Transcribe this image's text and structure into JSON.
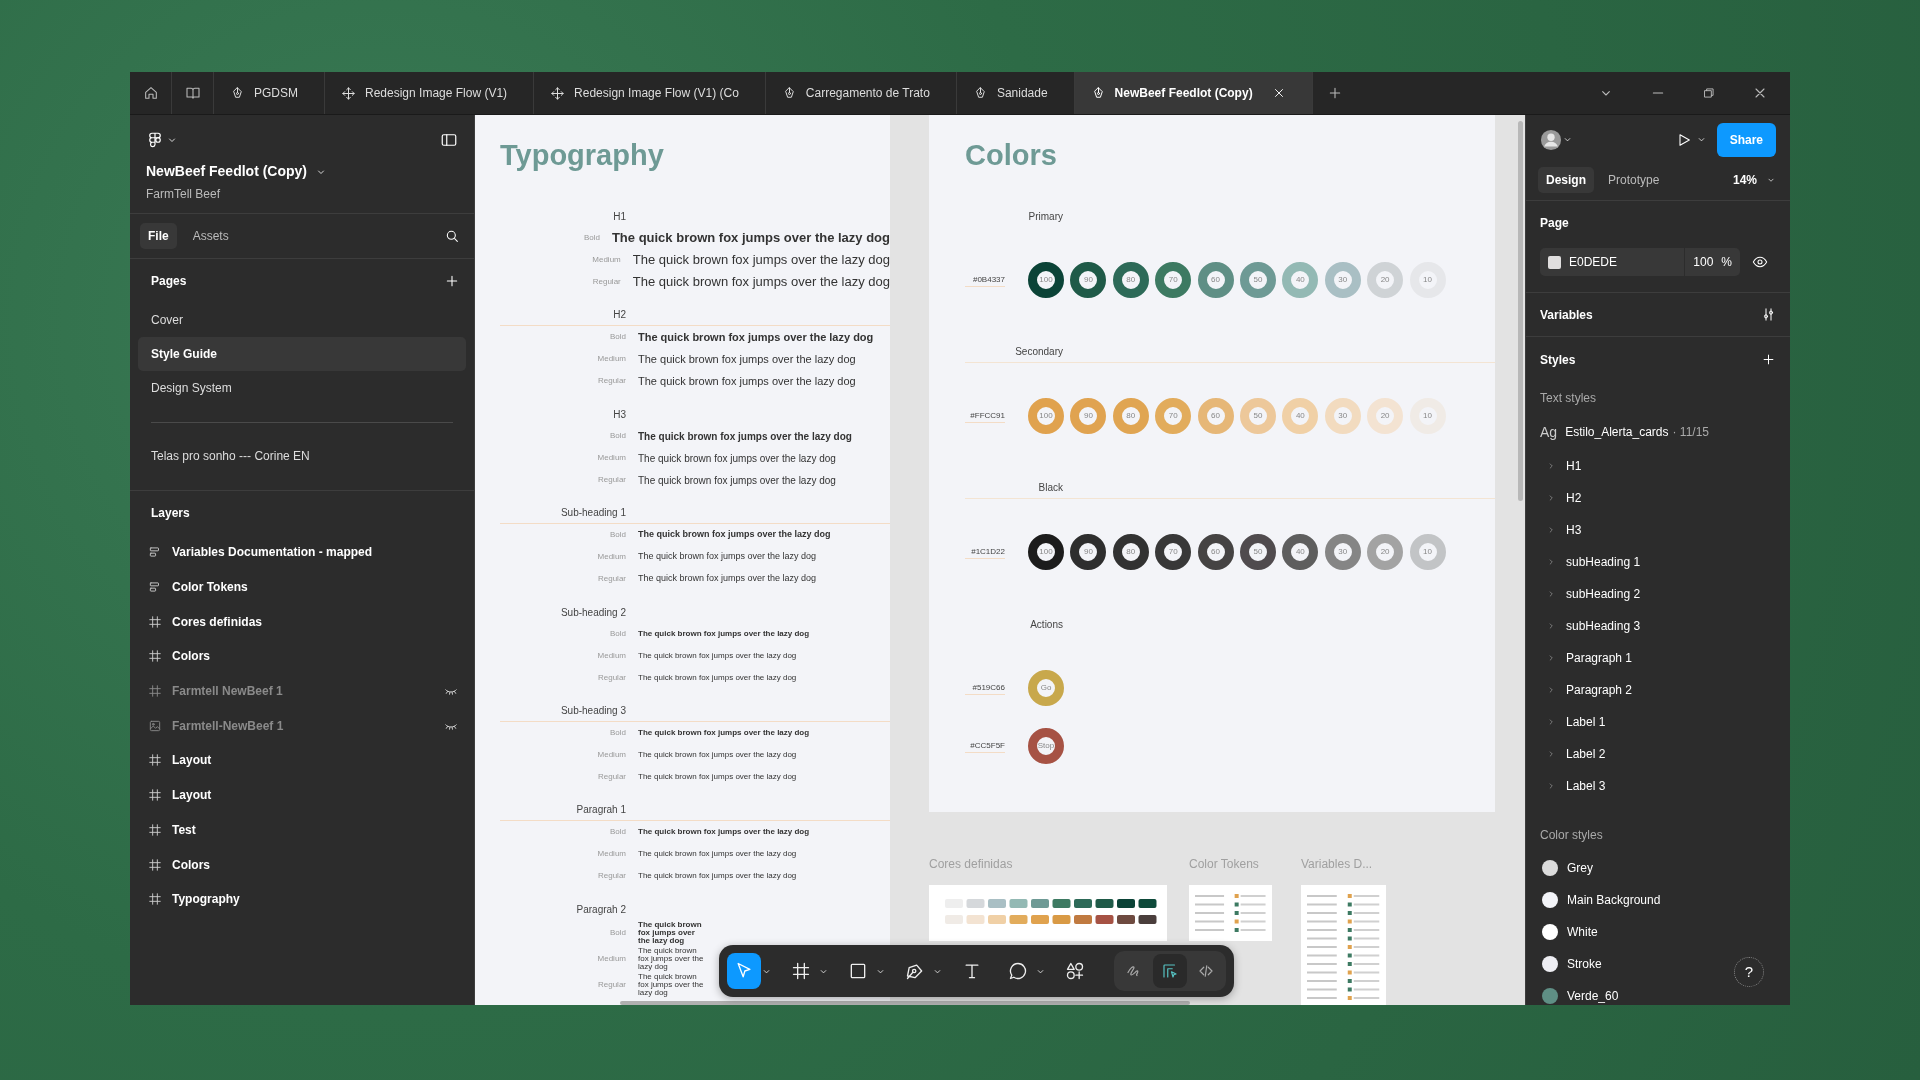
{
  "tabs": [
    {
      "label": "PGDSM",
      "kind": "design",
      "selected": false
    },
    {
      "label": "Redesign Image Flow (V1)",
      "kind": "flow",
      "selected": false
    },
    {
      "label": "Redesign Image Flow (V1) (Co",
      "kind": "flow",
      "selected": false
    },
    {
      "label": "Carregamento de Trato",
      "kind": "design",
      "selected": false
    },
    {
      "label": "Sanidade",
      "kind": "design",
      "selected": false
    },
    {
      "label": "NewBeef Feedlot (Copy)",
      "kind": "design",
      "selected": true
    }
  ],
  "left_panel": {
    "file_name": "NewBeef Feedlot (Copy)",
    "team": "FarmTell Beef",
    "tabs": [
      {
        "label": "File",
        "selected": true
      },
      {
        "label": "Assets",
        "selected": false
      }
    ],
    "pages_title": "Pages",
    "pages": [
      {
        "kind": "page",
        "label": "Cover",
        "selected": false
      },
      {
        "kind": "page",
        "label": "Style Guide",
        "selected": true
      },
      {
        "kind": "page",
        "label": "Design System",
        "selected": false
      },
      {
        "kind": "divider",
        "selected": false
      },
      {
        "kind": "page",
        "label": "Telas pro sonho --- Corine EN",
        "selected": false
      }
    ],
    "layers_title": "Layers",
    "layers": [
      {
        "label": "Variables Documentation - mapped",
        "kind": "section",
        "hidden": false
      },
      {
        "label": "Color Tokens",
        "kind": "section",
        "hidden": false
      },
      {
        "label": "Cores definidas",
        "kind": "frame",
        "hidden": false
      },
      {
        "label": "Colors",
        "kind": "frame",
        "hidden": false
      },
      {
        "label": "Farmtell NewBeef 1",
        "kind": "frame",
        "hidden": true
      },
      {
        "label": "Farmtell-NewBeef 1",
        "kind": "image",
        "hidden": true
      },
      {
        "label": "Layout",
        "kind": "frame",
        "hidden": false
      },
      {
        "label": "Layout",
        "kind": "frame",
        "hidden": false
      },
      {
        "label": "Test",
        "kind": "frame",
        "hidden": false
      },
      {
        "label": "Colors",
        "kind": "frame",
        "hidden": false
      },
      {
        "label": "Typography",
        "kind": "frame",
        "hidden": false
      }
    ]
  },
  "canvas": {
    "typography": {
      "title": "Typography",
      "sections": [
        {
          "heading": "H1",
          "rule": false,
          "rows": [
            {
              "kind": "bold",
              "label": "Bold",
              "sample": "The quick brown fox jumps over the lazy dog"
            },
            {
              "kind": "medium",
              "label": "Medium",
              "sample": "The quick brown fox jumps over the lazy dog"
            },
            {
              "kind": "regular",
              "label": "Regular",
              "sample": "The quick brown fox jumps over the lazy dog"
            }
          ]
        },
        {
          "heading": "H2",
          "rule": true,
          "rows": [
            {
              "kind": "bold",
              "label": "Bold",
              "sample": "The quick brown fox jumps over the lazy dog"
            },
            {
              "kind": "medium",
              "label": "Medium",
              "sample": "The quick brown fox jumps over the lazy dog"
            },
            {
              "kind": "regular",
              "label": "Regular",
              "sample": "The quick brown fox jumps over the lazy dog"
            }
          ]
        },
        {
          "heading": "H3",
          "rule": false,
          "rows": [
            {
              "kind": "bold",
              "label": "Bold",
              "sample": "The quick brown fox jumps over the lazy dog"
            },
            {
              "kind": "medium",
              "label": "Medium",
              "sample": "The quick brown fox jumps over the lazy dog"
            },
            {
              "kind": "regular",
              "label": "Regular",
              "sample": "The quick brown fox jumps over the lazy dog"
            }
          ]
        },
        {
          "heading": "Sub-heading 1",
          "rule": true,
          "rows": [
            {
              "kind": "bold",
              "label": "Bold",
              "sample": "The quick brown fox jumps over the lazy dog"
            },
            {
              "kind": "medium",
              "label": "Medium",
              "sample": "The quick brown fox jumps over the lazy dog"
            },
            {
              "kind": "regular",
              "label": "Regular",
              "sample": "The quick brown fox jumps over the lazy dog"
            }
          ]
        },
        {
          "heading": "Sub-heading 2",
          "rule": false,
          "rows": [
            {
              "kind": "bold",
              "label": "Bold",
              "sample": "The quick brown fox jumps over the lazy dog"
            },
            {
              "kind": "medium",
              "label": "Medium",
              "sample": "The quick brown fox jumps over the lazy dog"
            },
            {
              "kind": "regular",
              "label": "Regular",
              "sample": "The quick brown fox jumps over the lazy dog"
            }
          ]
        },
        {
          "heading": "Sub-heading 3",
          "rule": true,
          "rows": [
            {
              "kind": "bold",
              "label": "Bold",
              "sample": "The quick brown fox jumps over the lazy dog"
            },
            {
              "kind": "medium",
              "label": "Medium",
              "sample": "The quick brown fox jumps over the lazy dog"
            },
            {
              "kind": "regular",
              "label": "Regular",
              "sample": "The quick brown fox jumps over the lazy dog"
            }
          ]
        },
        {
          "heading": "Paragrah 1",
          "rule": true,
          "rows": [
            {
              "kind": "bold",
              "label": "Bold",
              "sample": "The quick brown fox jumps over the lazy dog"
            },
            {
              "kind": "medium",
              "label": "Medium",
              "sample": "The quick brown fox jumps over the lazy dog"
            },
            {
              "kind": "regular",
              "label": "Regular",
              "sample": "The quick brown fox jumps over the lazy dog"
            }
          ]
        },
        {
          "heading": "Paragrah 2",
          "rule": false,
          "rows": [
            {
              "kind": "bold",
              "label": "Bold",
              "sample": "The quick brown fox jumps over the lazy dog"
            },
            {
              "kind": "medium",
              "label": "Medium",
              "sample": "The quick brown fox jumps over the lazy dog"
            },
            {
              "kind": "regular",
              "label": "Regular",
              "sample": "The quick brown fox jumps over the lazy dog"
            }
          ]
        }
      ]
    },
    "colors": {
      "title": "Colors",
      "groups": [
        {
          "label": "Primary",
          "rule": false,
          "rows": [
            {
              "hex": "#0B4337",
              "swatches": [
                {
                  "label": "100",
                  "color": "#0b4337"
                },
                {
                  "label": "90",
                  "color": "#1f5a48"
                },
                {
                  "label": "80",
                  "color": "#2d6a58"
                },
                {
                  "label": "70",
                  "color": "#3d7a62"
                },
                {
                  "label": "60",
                  "color": "#5f8f85"
                },
                {
                  "label": "50",
                  "color": "#6e9a95"
                },
                {
                  "label": "40",
                  "color": "#93b9b4"
                },
                {
                  "label": "30",
                  "color": "#a9bfc4"
                },
                {
                  "label": "20",
                  "color": "#cfd3d6"
                },
                {
                  "label": "10",
                  "color": "#e6e7ea"
                }
              ]
            }
          ]
        },
        {
          "label": "Secondary",
          "rule": true,
          "rows": [
            {
              "hex": "#FFCC91",
              "swatches": [
                {
                  "label": "100",
                  "color": "#e0a24e"
                },
                {
                  "label": "90",
                  "color": "#e0a350"
                },
                {
                  "label": "80",
                  "color": "#e0a552"
                },
                {
                  "label": "70",
                  "color": "#e2ac5c"
                },
                {
                  "label": "60",
                  "color": "#e6b777"
                },
                {
                  "label": "50",
                  "color": "#edc89a"
                },
                {
                  "label": "40",
                  "color": "#f0d0a6"
                },
                {
                  "label": "30",
                  "color": "#f2dbbf"
                },
                {
                  "label": "20",
                  "color": "#f3e3d2"
                },
                {
                  "label": "10",
                  "color": "#f0ebe6"
                }
              ]
            }
          ]
        },
        {
          "label": "Black",
          "rule": true,
          "rows": [
            {
              "hex": "#1C1D22",
              "swatches": [
                {
                  "label": "100",
                  "color": "#1c1c1c"
                },
                {
                  "label": "90",
                  "color": "#2e2e2e"
                },
                {
                  "label": "80",
                  "color": "#323232"
                },
                {
                  "label": "70",
                  "color": "#383838"
                },
                {
                  "label": "60",
                  "color": "#454343"
                },
                {
                  "label": "50",
                  "color": "#504b4e"
                },
                {
                  "label": "40",
                  "color": "#5e5e5e"
                },
                {
                  "label": "30",
                  "color": "#858585"
                },
                {
                  "label": "20",
                  "color": "#a3a3a3"
                },
                {
                  "label": "10",
                  "color": "#c2c4c6"
                }
              ]
            }
          ]
        },
        {
          "label": "Actions",
          "rule": false,
          "rows": [
            {
              "hex": "#519C66",
              "swatches": [
                {
                  "label": "Go",
                  "color": "#c8a84c"
                }
              ]
            },
            {
              "hex": "#CC5F5F",
              "swatches": [
                {
                  "label": "Stop",
                  "color": "#a65244"
                }
              ]
            }
          ]
        }
      ]
    },
    "thumbnails": [
      {
        "label": "Cores definidas",
        "kind": "swatches"
      },
      {
        "label": "Color Tokens",
        "kind": "table"
      },
      {
        "label": "Variables D...",
        "kind": "table"
      }
    ],
    "toolbar": {
      "tools": [
        {
          "kind": "move",
          "selected": true,
          "menu": true
        },
        {
          "kind": "frame",
          "selected": false,
          "menu": true
        },
        {
          "kind": "rectangle",
          "selected": false,
          "menu": true
        },
        {
          "kind": "pen",
          "selected": false,
          "menu": true
        },
        {
          "kind": "text",
          "selected": false,
          "menu": false
        },
        {
          "kind": "comment",
          "selected": false,
          "menu": true
        },
        {
          "kind": "actions",
          "selected": false,
          "menu": false
        }
      ],
      "modes": [
        {
          "kind": "draw",
          "selected": false
        },
        {
          "kind": "design",
          "selected": true
        },
        {
          "kind": "dev",
          "selected": false
        }
      ]
    }
  },
  "right_panel": {
    "share": "Share",
    "tabs": [
      {
        "label": "Design",
        "selected": true
      },
      {
        "label": "Prototype",
        "selected": false
      }
    ],
    "zoom": "14%",
    "page_title": "Page",
    "page_fill": {
      "color": "#e0dede",
      "hex": "E0DEDE",
      "opacity": "100",
      "unit": "%"
    },
    "variables_title": "Variables",
    "styles_title": "Styles",
    "text_styles_title": "Text styles",
    "text_style_group": {
      "icon_text": "Ag",
      "label": "Estilo_Alerta_cards",
      "count": "· 11/15"
    },
    "text_styles": [
      {
        "label": "H1",
        "expanded": false
      },
      {
        "label": "H2",
        "expanded": false
      },
      {
        "label": "H3",
        "expanded": false
      },
      {
        "label": "subHeading 1",
        "expanded": false
      },
      {
        "label": "subHeading 2",
        "expanded": false
      },
      {
        "label": "subHeading 3",
        "expanded": false
      },
      {
        "label": "Paragraph 1",
        "expanded": false
      },
      {
        "label": "Paragraph 2",
        "expanded": false
      },
      {
        "label": "Label 1",
        "expanded": false
      },
      {
        "label": "Label 2",
        "expanded": false
      },
      {
        "label": "Label 3",
        "expanded": false
      }
    ],
    "color_styles_title": "Color styles",
    "color_styles": [
      {
        "label": "Grey",
        "color": "#dcdcdc"
      },
      {
        "label": "Main Background",
        "color": "#f3f4f8"
      },
      {
        "label": "White",
        "color": "#ffffff"
      },
      {
        "label": "Stroke",
        "color": "#eeeef3"
      },
      {
        "label": "Verde_60",
        "color": "#5f8f85"
      }
    ],
    "help": "?"
  }
}
